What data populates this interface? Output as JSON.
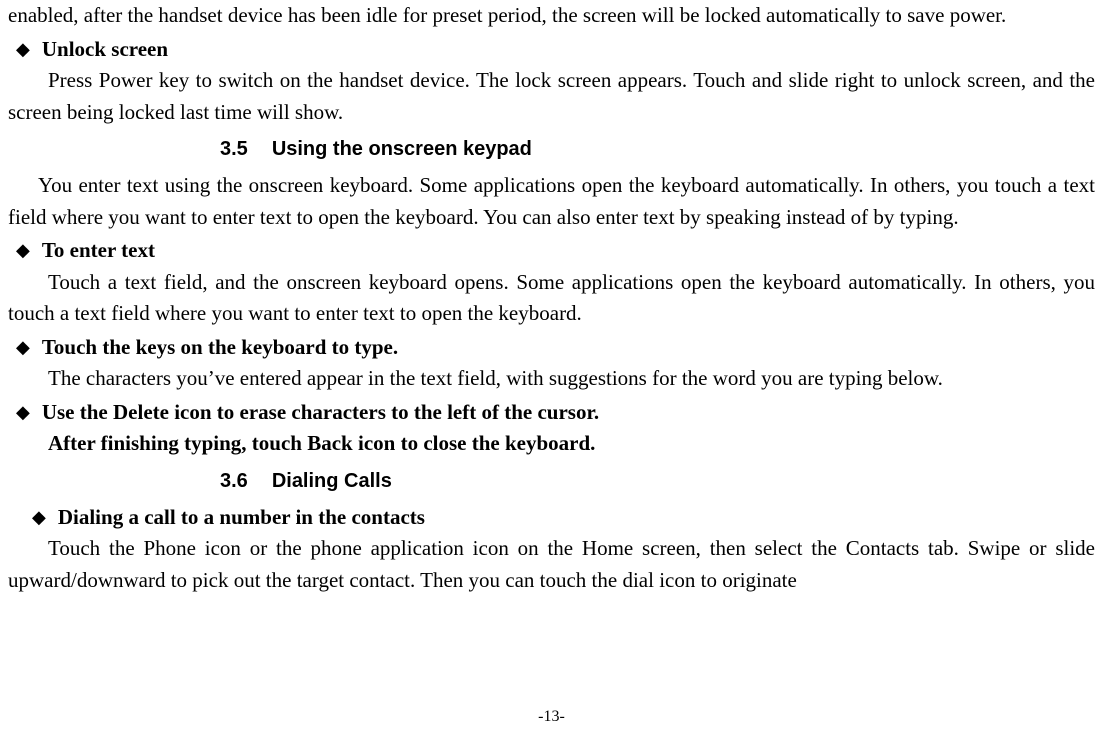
{
  "top_fragment": "enabled, after the handset device has been idle for preset period, the screen will be locked automatically to save power.",
  "bullets": {
    "unlock_screen": {
      "title": "Unlock screen",
      "body": "Press Power key to switch on the handset device. The lock screen appears. Touch and slide right to unlock screen, and the screen being locked last time will show."
    },
    "to_enter_text": {
      "title": "To enter text",
      "body": "Touch a text field, and the onscreen keyboard opens. Some applications open the keyboard automatically. In others, you touch a text field where you want to enter text to open the keyboard."
    },
    "touch_keys": {
      "title": "Touch the keys on the keyboard to type.",
      "body": "The characters you’ve entered appear in the text field, with suggestions for the word you are typing below."
    },
    "delete_icon": {
      "title": "Use the Delete icon to erase characters to the left of the cursor.",
      "after": "After finishing typing, touch Back icon to close the keyboard."
    },
    "dial_contacts": {
      "title": "Dialing a call to a number in the contacts",
      "body": "Touch the Phone icon or the phone application icon on the Home screen, then select the Contacts tab. Swipe or slide upward/downward to pick out the target contact. Then you can touch the dial icon to originate"
    }
  },
  "sections": {
    "s35": {
      "num": "3.5",
      "title": "Using the onscreen keypad"
    },
    "s36": {
      "num": "3.6",
      "title": "Dialing Calls"
    }
  },
  "s35_intro": "You enter text using the onscreen keyboard. Some applications open the keyboard automatically. In others, you touch a text field where you want to enter text to open the keyboard. You can also enter text by speaking instead of by typing.",
  "page_number": "-13-"
}
